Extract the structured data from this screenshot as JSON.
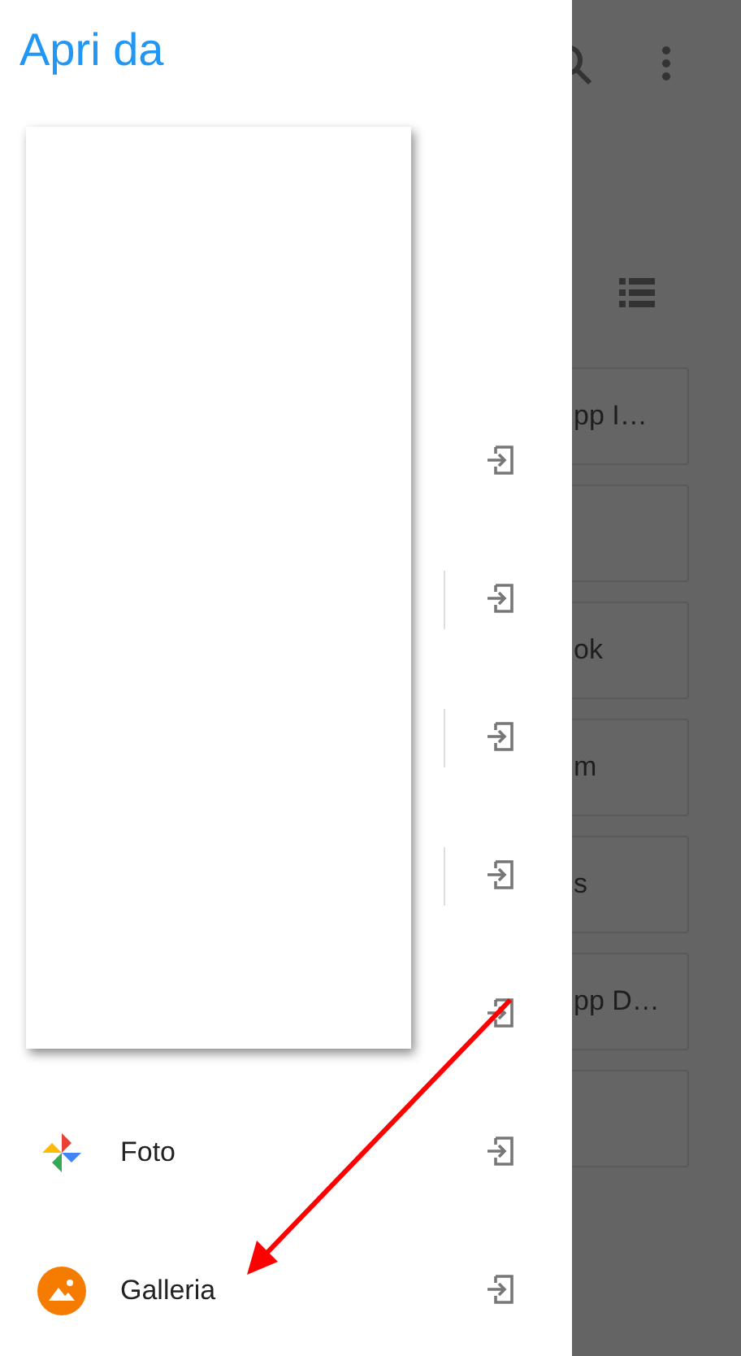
{
  "drawer": {
    "title": "Apri da",
    "rows": [
      {
        "kind": "covered"
      },
      {
        "kind": "covered_split"
      },
      {
        "kind": "covered_split"
      },
      {
        "kind": "covered_split"
      },
      {
        "kind": "covered"
      },
      {
        "kind": "app",
        "label": "Foto"
      },
      {
        "kind": "app",
        "label": "Galleria"
      }
    ]
  },
  "background": {
    "cards": [
      {
        "kind": "named",
        "text": "pp I…"
      },
      {
        "kind": "blank"
      },
      {
        "kind": "named",
        "text": "ok"
      },
      {
        "kind": "named",
        "text": "m"
      },
      {
        "kind": "named",
        "text": "s"
      },
      {
        "kind": "named",
        "text": "pp D…"
      },
      {
        "kind": "blank"
      }
    ]
  }
}
